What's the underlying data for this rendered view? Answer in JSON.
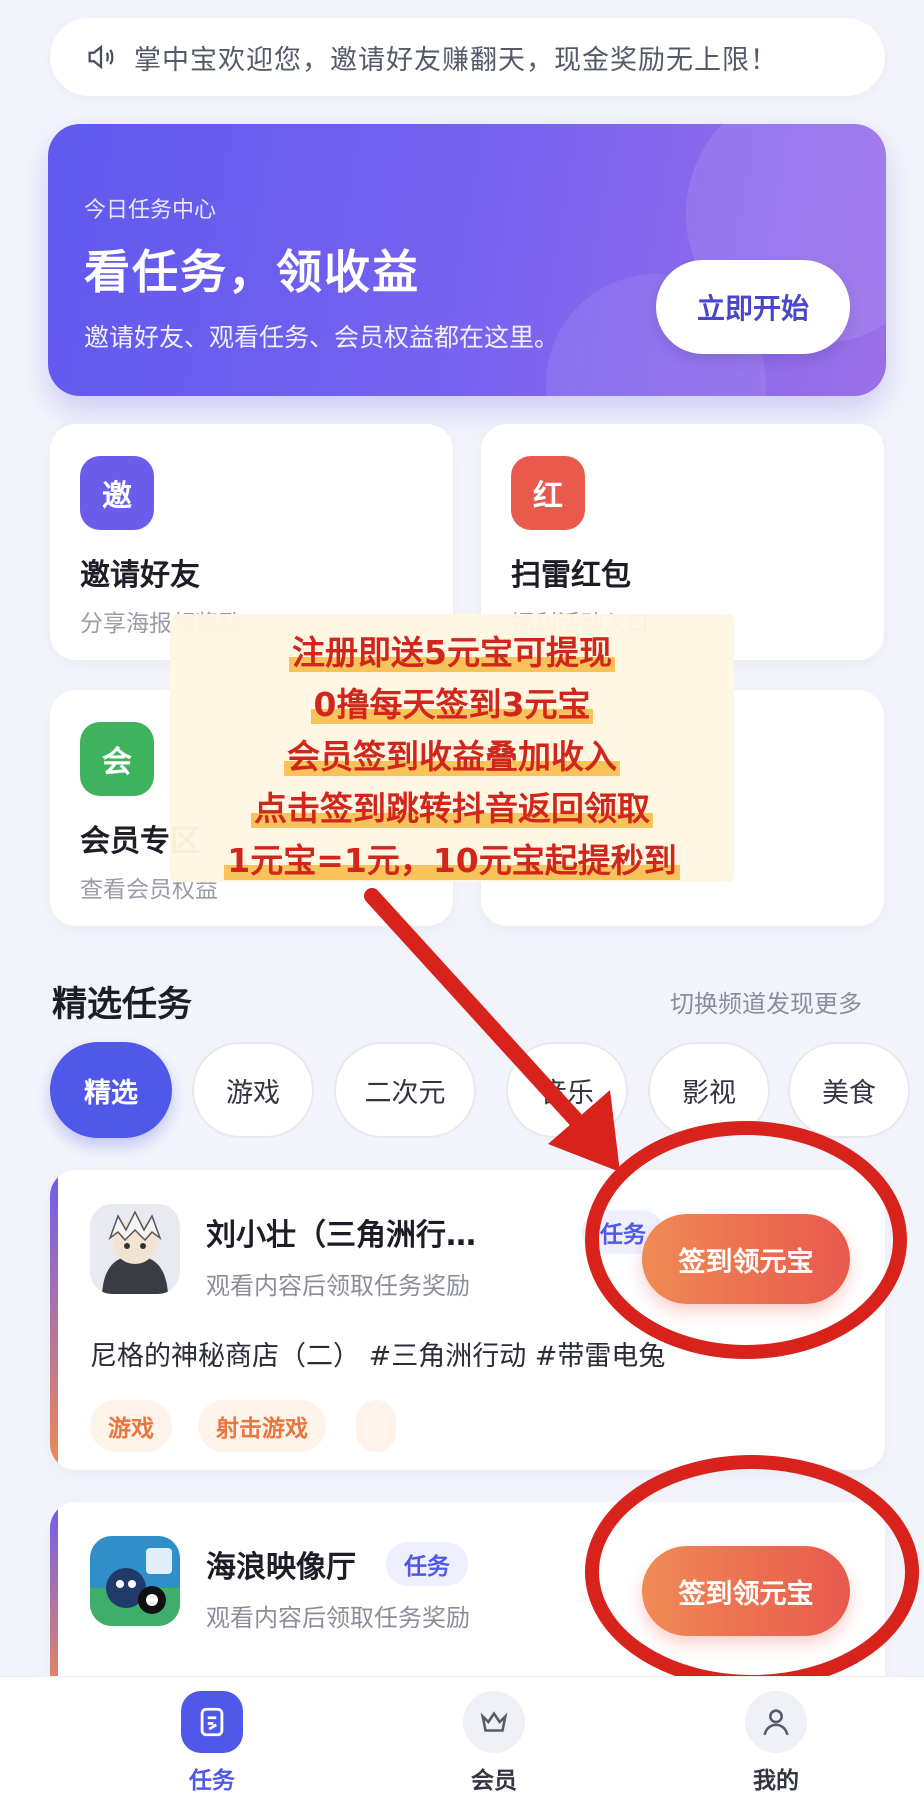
{
  "notice": {
    "text": "掌中宝欢迎您，邀请好友赚翻天，现金奖励无上限！",
    "icon": "speaker-icon"
  },
  "hero": {
    "subtitle": "今日任务中心",
    "title": "看任务，领收益",
    "desc": "邀请好友、观看任务、会员权益都在这里。",
    "button": "立即开始"
  },
  "features": [
    {
      "badge": "邀",
      "name": "邀请好友",
      "note": "分享海报领奖励",
      "color": "#6b5ce9"
    },
    {
      "badge": "红",
      "name": "扫雷红包",
      "note": "福利活动入口",
      "color": "#ea5a4c"
    },
    {
      "badge": "会",
      "name": "会员专区",
      "note": "查看会员权益",
      "color": "#3fb25e"
    }
  ],
  "promo": {
    "lines": [
      "注册即送5元宝可提现",
      "0撸每天签到3元宝",
      "会员签到收益叠加收入",
      "点击签到跳转抖音返回领取",
      "1元宝=1元，10元宝起提秒到"
    ]
  },
  "section": {
    "title": "精选任务",
    "more": "切换频道发现更多"
  },
  "tabs": [
    "精选",
    "游戏",
    "二次元",
    "音乐",
    "影视",
    "美食"
  ],
  "tasks": [
    {
      "name": "刘小壮（三角洲行…",
      "tag": "任务",
      "sub": "观看内容后领取任务奖励",
      "claim": "签到领元宝",
      "desc": "尼格的神秘商店（二） #三角洲行动 #带雷电兔",
      "tags": [
        "游戏",
        "射击游戏"
      ]
    },
    {
      "name": "海浪映像厅",
      "tag": "任务",
      "sub": "观看内容后领取任务奖励",
      "claim": "签到领元宝",
      "desc": "",
      "tags": []
    }
  ],
  "nav": [
    {
      "label": "任务",
      "icon": "task-icon"
    },
    {
      "label": "会员",
      "icon": "crown-icon"
    },
    {
      "label": "我的",
      "icon": "user-icon"
    }
  ],
  "colors": {
    "accent": "#4f58e8",
    "claim": "#e8594d",
    "annotation": "#d8231c"
  }
}
